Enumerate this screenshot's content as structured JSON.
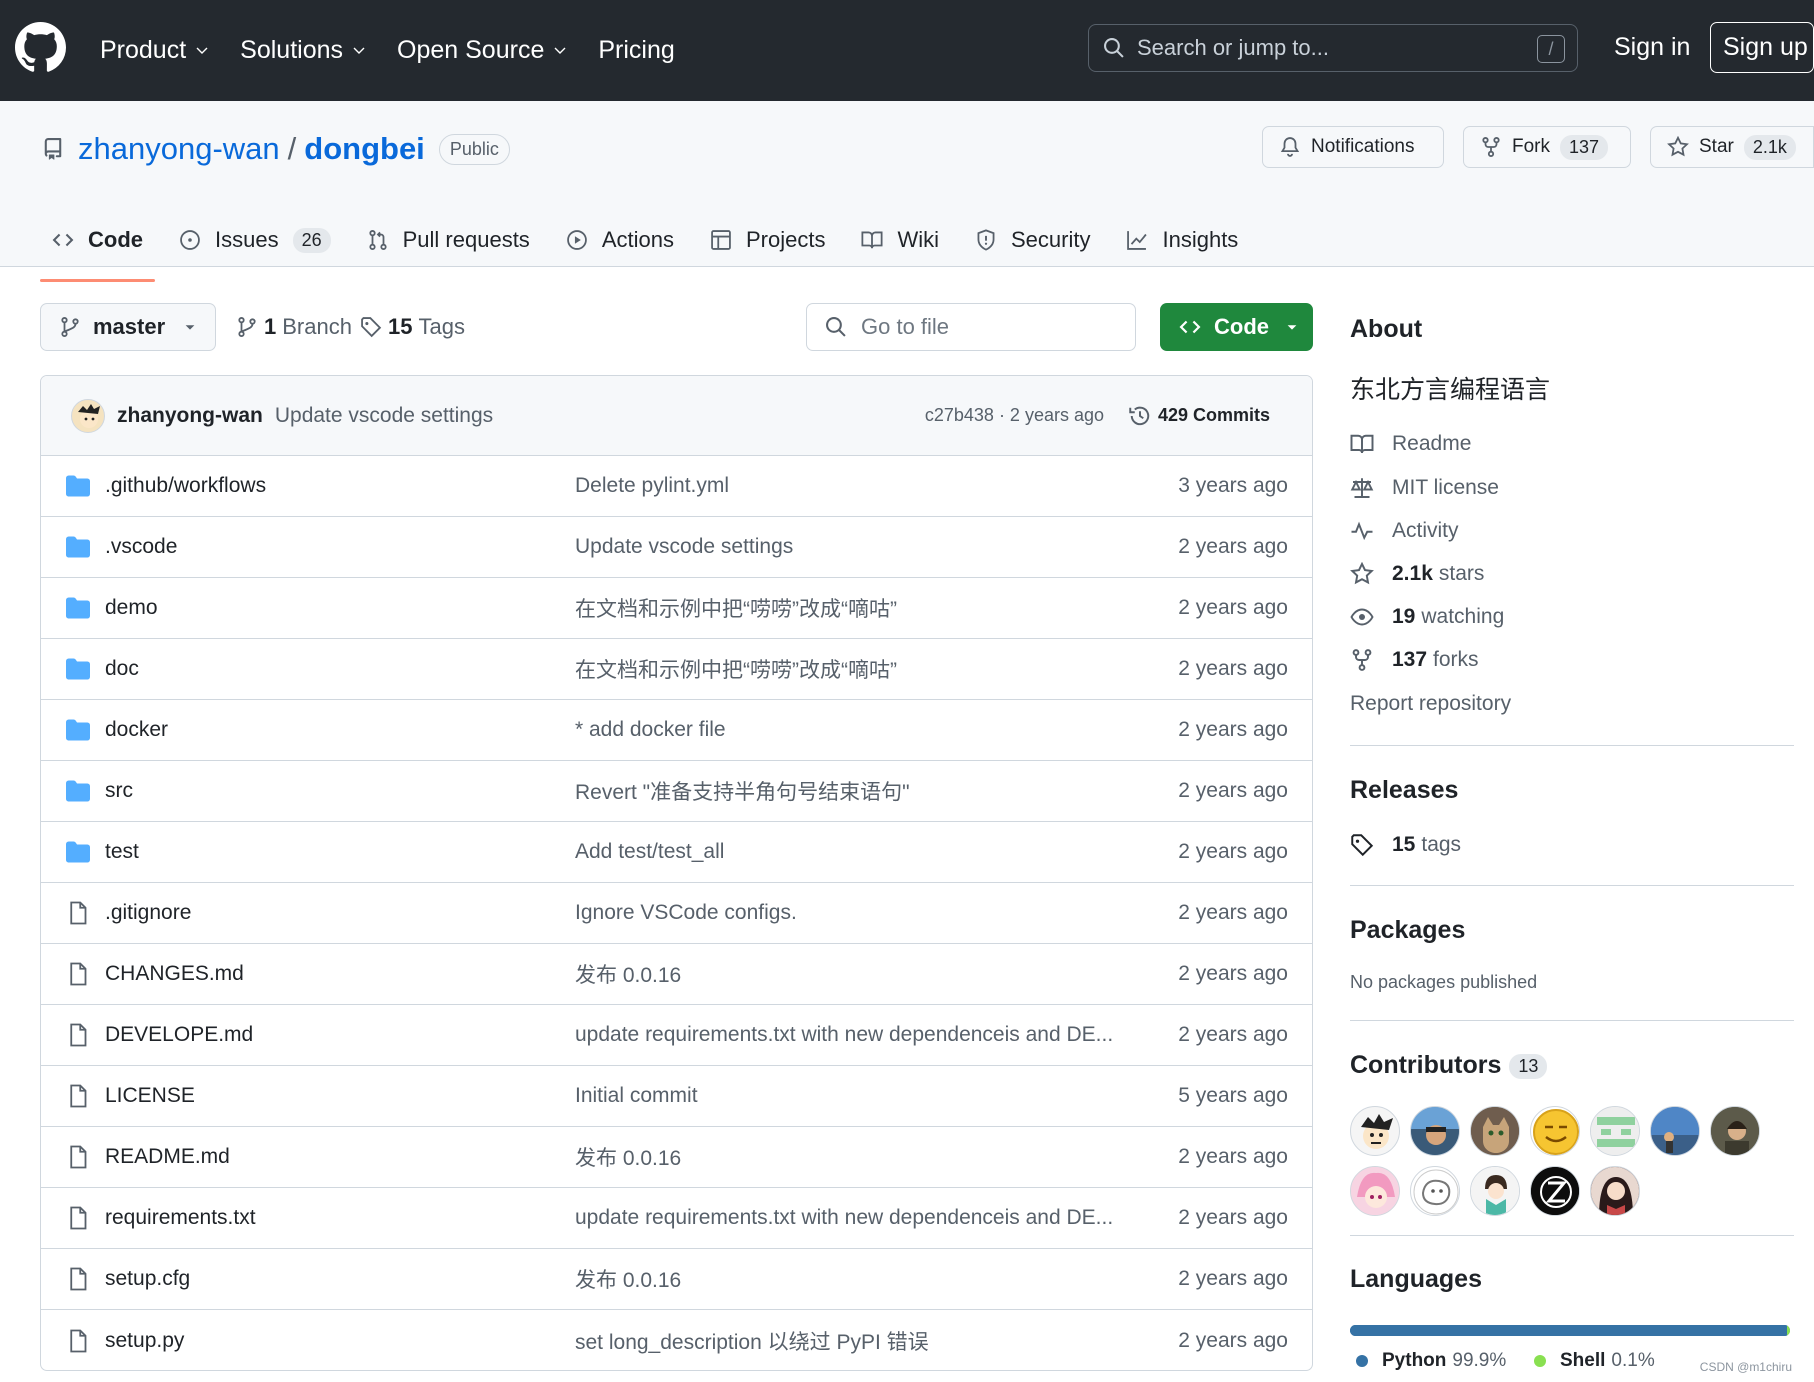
{
  "topbar": {
    "nav": [
      {
        "label": "Product",
        "has_menu": true
      },
      {
        "label": "Solutions",
        "has_menu": true
      },
      {
        "label": "Open Source",
        "has_menu": true
      },
      {
        "label": "Pricing",
        "has_menu": false
      }
    ],
    "search_placeholder": "Search or jump to...",
    "search_shortcut": "/",
    "sign_in": "Sign in",
    "sign_up": "Sign up"
  },
  "repo": {
    "owner": "zhanyong-wan",
    "separator": "/",
    "name": "dongbei",
    "visibility": "Public",
    "notifications_label": "Notifications",
    "fork_label": "Fork",
    "fork_count": "137",
    "star_label": "Star",
    "star_count": "2.1k"
  },
  "tabs": [
    {
      "label": "Code",
      "icon": "code-icon",
      "active": true
    },
    {
      "label": "Issues",
      "icon": "issue-icon",
      "count": "26"
    },
    {
      "label": "Pull requests",
      "icon": "pull-request-icon"
    },
    {
      "label": "Actions",
      "icon": "play-icon"
    },
    {
      "label": "Projects",
      "icon": "table-icon"
    },
    {
      "label": "Wiki",
      "icon": "book-icon"
    },
    {
      "label": "Security",
      "icon": "shield-icon"
    },
    {
      "label": "Insights",
      "icon": "graph-icon"
    }
  ],
  "toolbar": {
    "branch": "master",
    "branch_count": "1",
    "branch_label": "Branch",
    "tag_count": "15",
    "tag_label": "Tags",
    "go_to_file": "Go to file",
    "code_button": "Code"
  },
  "latest_commit": {
    "author": "zhanyong-wan",
    "message": "Update vscode settings",
    "sha_time": "c27b438 · 2 years ago",
    "commits": "429 Commits"
  },
  "files": [
    {
      "type": "dir",
      "name": ".github/workflows",
      "message": "Delete pylint.yml",
      "time": "3 years ago"
    },
    {
      "type": "dir",
      "name": ".vscode",
      "message": "Update vscode settings",
      "time": "2 years ago"
    },
    {
      "type": "dir",
      "name": "demo",
      "message": "在文档和示例中把“唠唠”改成“嘀咕”",
      "time": "2 years ago"
    },
    {
      "type": "dir",
      "name": "doc",
      "message": "在文档和示例中把“唠唠”改成“嘀咕”",
      "time": "2 years ago"
    },
    {
      "type": "dir",
      "name": "docker",
      "message": "* add docker file",
      "time": "2 years ago"
    },
    {
      "type": "dir",
      "name": "src",
      "message": "Revert \"准备支持半角句号结束语句\"",
      "time": "2 years ago"
    },
    {
      "type": "dir",
      "name": "test",
      "message": "Add test/test_all",
      "time": "2 years ago"
    },
    {
      "type": "file",
      "name": ".gitignore",
      "message": "Ignore VSCode configs.",
      "time": "2 years ago"
    },
    {
      "type": "file",
      "name": "CHANGES.md",
      "message": "发布 0.0.16",
      "time": "2 years ago"
    },
    {
      "type": "file",
      "name": "DEVELOPE.md",
      "message": "update requirements.txt with new dependenceis and DE...",
      "time": "2 years ago"
    },
    {
      "type": "file",
      "name": "LICENSE",
      "message": "Initial commit",
      "time": "5 years ago"
    },
    {
      "type": "file",
      "name": "README.md",
      "message": "发布 0.0.16",
      "time": "2 years ago"
    },
    {
      "type": "file",
      "name": "requirements.txt",
      "message": "update requirements.txt with new dependenceis and DE...",
      "time": "2 years ago"
    },
    {
      "type": "file",
      "name": "setup.cfg",
      "message": "发布 0.0.16",
      "time": "2 years ago"
    },
    {
      "type": "file",
      "name": "setup.py",
      "message": "set long_description 以绕过 PyPI 错误",
      "time": "2 years ago"
    }
  ],
  "about": {
    "heading": "About",
    "description": "东北方言编程语言",
    "readme": "Readme",
    "license": "MIT license",
    "activity": "Activity",
    "stars_count": "2.1k",
    "stars_label": "stars",
    "watching_count": "19",
    "watching_label": "watching",
    "forks_count": "137",
    "forks_label": "forks",
    "report": "Report repository"
  },
  "releases": {
    "heading": "Releases",
    "tags_count": "15",
    "tags_label": "tags"
  },
  "packages": {
    "heading": "Packages",
    "empty": "No packages published"
  },
  "contributors": {
    "heading": "Contributors",
    "count": "13"
  },
  "languages": {
    "heading": "Languages",
    "items": [
      {
        "name": "Python",
        "percent": "99.9%",
        "value": 99.9,
        "color": "#3572a5"
      },
      {
        "name": "Shell",
        "percent": "0.1%",
        "value": 0.1,
        "color": "#89e051"
      }
    ]
  },
  "watermark": "CSDN @m1chiru",
  "colors": {
    "header_bg": "#24292f",
    "link": "#0969da",
    "primary_button": "#1f883d",
    "folder": "#54aeff",
    "active_tab_underline": "#fd8c73"
  }
}
